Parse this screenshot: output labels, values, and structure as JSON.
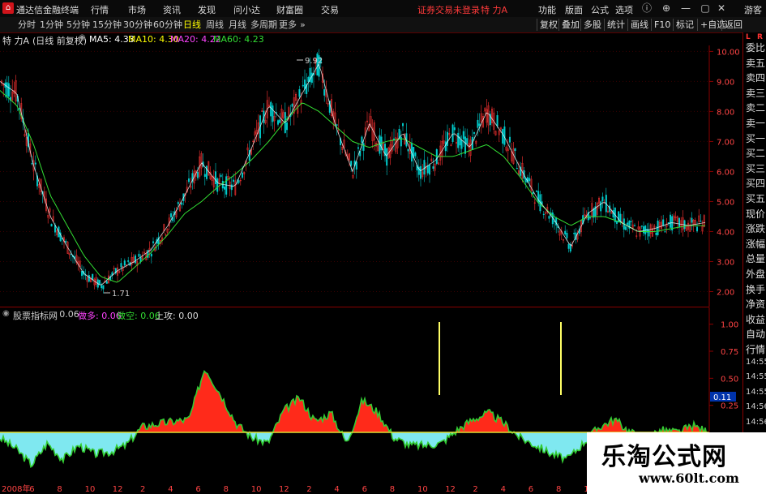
{
  "titlebar": {
    "app_name": "通达信金融终端",
    "menus": [
      "行情",
      "市场",
      "资讯",
      "发现",
      "问小达",
      "财富圈",
      "交易"
    ],
    "warning": "证券交易未登录",
    "stock_label": "特 力A",
    "right_menus": [
      "功能",
      "版面",
      "公式",
      "选项"
    ],
    "guest": "游客"
  },
  "toolbar": {
    "periods": [
      "分时",
      "1分钟",
      "5分钟",
      "15分钟",
      "30分钟",
      "60分钟",
      "日线",
      "周线",
      "月线",
      "多周期",
      "更多"
    ],
    "active_period": "日线",
    "right_buttons": [
      "复权",
      "叠加",
      "多股",
      "统计",
      "画线",
      "F10",
      "标记",
      "+自选",
      "返回"
    ]
  },
  "info": {
    "stock": "特 力A",
    "mode": "(日线 前复权)",
    "ma": [
      {
        "label": "MA5:",
        "value": "4.33",
        "color": "#ffffff"
      },
      {
        "label": "MA10:",
        "value": "4.30",
        "color": "#ffff00"
      },
      {
        "label": "MA20:",
        "value": "4.22",
        "color": "#ff44ff"
      },
      {
        "label": "MA60:",
        "value": "4.23",
        "color": "#33dd33"
      }
    ]
  },
  "indicator": {
    "name": "股票指标网",
    "value": ": 0.06",
    "items": [
      {
        "label": "做多:",
        "value": "0.06",
        "color": "#ff44ff"
      },
      {
        "label": "做空:",
        "value": "0.06",
        "color": "#33dd33"
      },
      {
        "label": "上攻:",
        "value": "0.00",
        "color": "#dddddd"
      }
    ]
  },
  "right_panel": {
    "l_label": "L",
    "r_label": "R",
    "items": [
      "委比",
      "卖五",
      "卖四",
      "卖三",
      "卖二",
      "卖一",
      "买一",
      "买二",
      "买三",
      "买四",
      "买五",
      "现价",
      "涨跌",
      "涨幅",
      "总量",
      "外盘",
      "换手",
      "净资",
      "收益",
      "自动",
      "行情",
      "14:55",
      "14:55",
      "14:55",
      "14:56",
      "14:56",
      "14:56",
      "14:56",
      "14:56"
    ]
  },
  "price_axis": [
    "10.00",
    "9.00",
    "8.00",
    "7.00",
    "6.00",
    "5.00",
    "4.00",
    "3.00",
    "2.00"
  ],
  "indicator_axis": [
    "1.00",
    "0.75",
    "0.50",
    "0.25",
    "-0.25"
  ],
  "current_indicator": "0.11",
  "annotations": {
    "high": "9.92",
    "low": "1.71"
  },
  "time_axis": [
    "2008年",
    "6",
    "8",
    "10",
    "12",
    "2",
    "4",
    "6",
    "8",
    "10",
    "12",
    "2",
    "4",
    "6",
    "8",
    "10",
    "12",
    "2",
    "4",
    "6",
    "8",
    "10",
    "12",
    "2",
    "4",
    "6"
  ],
  "watermark": {
    "cn": "乐淘公式网",
    "url": "www.60lt.com"
  },
  "colors": {
    "up": "#ff3333",
    "down": "#00cccc",
    "ma5": "#ffffff",
    "ma10": "#ffff00",
    "ma20": "#ff44ff",
    "ma60": "#33dd33",
    "grid": "#8a0000",
    "indicator_pos": "#ff2a1a",
    "indicator_neg": "#7fe8f0",
    "indicator_line": "#33cc33",
    "spike": "#ffff66"
  },
  "chart_data": {
    "type": "line",
    "title": "",
    "series": [
      {
        "name": "MA60",
        "values": [
          8.7,
          8.2,
          6.9,
          5.2,
          4.2,
          3.2,
          2.5,
          2.3,
          2.8,
          3.3,
          3.9,
          4.6,
          5.0,
          5.5,
          5.9,
          6.4,
          7.0,
          7.7,
          8.3,
          8.0,
          7.5,
          7.0,
          6.8,
          7.0,
          7.1,
          6.8,
          6.5,
          6.5,
          6.7,
          6.9,
          6.5,
          5.8,
          5.0,
          4.5,
          4.2,
          4.5,
          4.5,
          4.3,
          4.0,
          4.0,
          4.1,
          4.2,
          4.2
        ]
      },
      {
        "name": "MA5",
        "values": [
          9.0,
          8.6,
          6.2,
          4.5,
          3.5,
          2.6,
          2.2,
          2.7,
          3.0,
          3.4,
          4.2,
          5.2,
          6.3,
          5.6,
          5.5,
          6.8,
          8.2,
          7.6,
          8.6,
          9.6,
          7.5,
          6.0,
          7.6,
          6.5,
          7.3,
          6.0,
          6.4,
          7.3,
          6.8,
          8.0,
          7.2,
          6.1,
          5.1,
          4.4,
          3.5,
          4.6,
          5.0,
          4.3,
          4.0,
          4.1,
          4.3,
          4.2,
          4.3
        ]
      }
    ],
    "ylim": [
      1.5,
      10.2
    ],
    "indicator_series": {
      "name": "股票指标网",
      "values": [
        -0.05,
        -0.15,
        -0.3,
        -0.1,
        -0.25,
        -0.12,
        -0.2,
        -0.18,
        -0.12,
        0.05,
        0.08,
        0.1,
        0.12,
        0.6,
        0.35,
        0.08,
        -0.05,
        -0.1,
        0.2,
        0.32,
        0.1,
        0.18,
        -0.1,
        0.3,
        0.18,
        -0.05,
        -0.12,
        -0.12,
        -0.1,
        0.02,
        0.12,
        0.18,
        0.08,
        -0.05,
        -0.12,
        -0.2,
        -0.25,
        -0.1,
        0.05,
        0.12,
        0.0,
        -0.05,
        0.02,
        0.0,
        0.06,
        0.0
      ]
    },
    "indicator_ylim": [
      -0.45,
      1.05
    ]
  }
}
